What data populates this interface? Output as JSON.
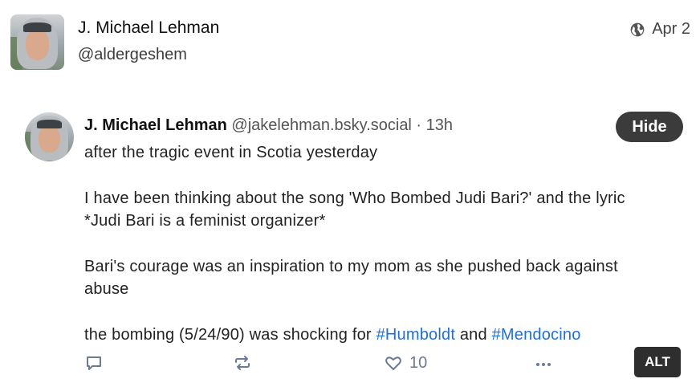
{
  "outer_post": {
    "author_name": "J. Michael Lehman",
    "handle": "@aldergeshem",
    "date": "Apr 2",
    "visibility_icon": "globe-icon"
  },
  "quoted_post": {
    "author_name": "J. Michael Lehman",
    "meta": "@jakelehman.bsky.social · 13h",
    "hide_label": "Hide",
    "paragraphs": [
      "after the tragic event in Scotia yesterday",
      "I have been thinking about the song 'Who Bombed Judi Bari?' and the lyric *Judi Bari is a feminist organizer*",
      "Bari's courage was an inspiration to my mom as she pushed back against abuse"
    ],
    "last_line": {
      "prefix": "the bombing (5/24/90) was shocking for ",
      "tag1": "#Humboldt",
      "middle": " and ",
      "tag2": "#Mendocino"
    },
    "actions": {
      "reply_icon": "reply-icon",
      "repost_icon": "repost-icon",
      "like_icon": "heart-icon",
      "like_count": "10",
      "more_icon": "more-icon"
    },
    "alt_label": "ALT"
  },
  "colors": {
    "hashtag": "#1f6fd6",
    "action_gray": "#6b7c92",
    "badge_dark": "#3b3b3b"
  }
}
